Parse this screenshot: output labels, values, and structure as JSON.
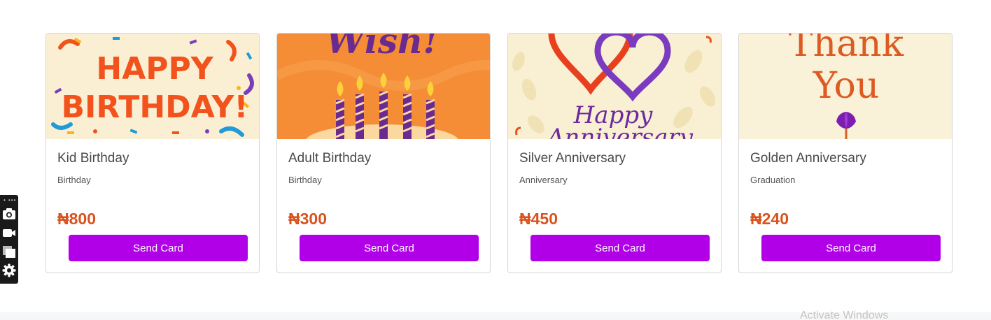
{
  "cards": [
    {
      "title": "Kid Birthday",
      "category": "Birthday",
      "price": "₦800",
      "button": "Send Card",
      "image_text": [
        "HAPPY",
        "BIRTHDAY!"
      ]
    },
    {
      "title": "Adult Birthday",
      "category": "Birthday",
      "price": "₦300",
      "button": "Send Card",
      "image_text": [
        "Wish!"
      ]
    },
    {
      "title": "Silver Anniversary",
      "category": "Anniversary",
      "price": "₦450",
      "button": "Send Card",
      "image_text": [
        "Happy",
        "Anniversary"
      ]
    },
    {
      "title": "Golden Anniversary",
      "category": "Graduation",
      "price": "₦240",
      "button": "Send Card",
      "image_text": [
        "Thank",
        "You"
      ]
    }
  ],
  "toolbar": {
    "icons": [
      "camera-icon",
      "video-icon",
      "copy-icon",
      "gear-icon"
    ]
  },
  "watermark": "Activate Windows",
  "colors": {
    "accent_button": "#b100e8",
    "price": "#d9531e"
  }
}
